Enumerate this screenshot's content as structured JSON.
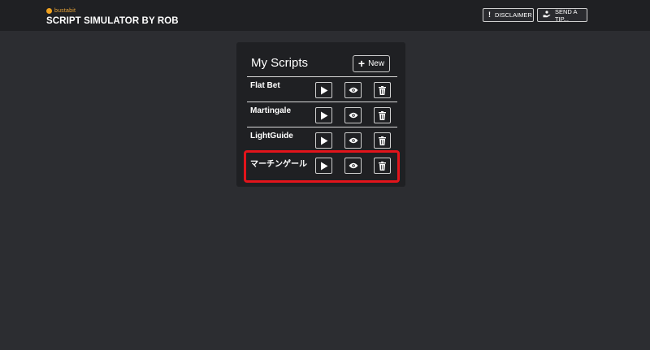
{
  "header": {
    "logo_text": "bustabit",
    "title": "SCRIPT SIMULATOR BY ROB",
    "disclaimer_label": "DISCLAIMER",
    "tip_label": "SEND A TIP..."
  },
  "panel": {
    "title": "My Scripts",
    "new_label": "New"
  },
  "scripts": [
    {
      "name": "Flat Bet"
    },
    {
      "name": "Martingale"
    },
    {
      "name": "LightGuide"
    },
    {
      "name": "マーチンゲール"
    }
  ],
  "colors": {
    "background": "#2c2d31",
    "panel": "#1f2023",
    "highlight": "#e3141b",
    "logo": "#f0a21f"
  },
  "icons": {
    "run": "play-icon",
    "view": "eye-icon",
    "delete": "trash-icon",
    "new": "plus-icon",
    "disclaimer": "exclamation-icon",
    "tip": "hand-coin-icon"
  }
}
